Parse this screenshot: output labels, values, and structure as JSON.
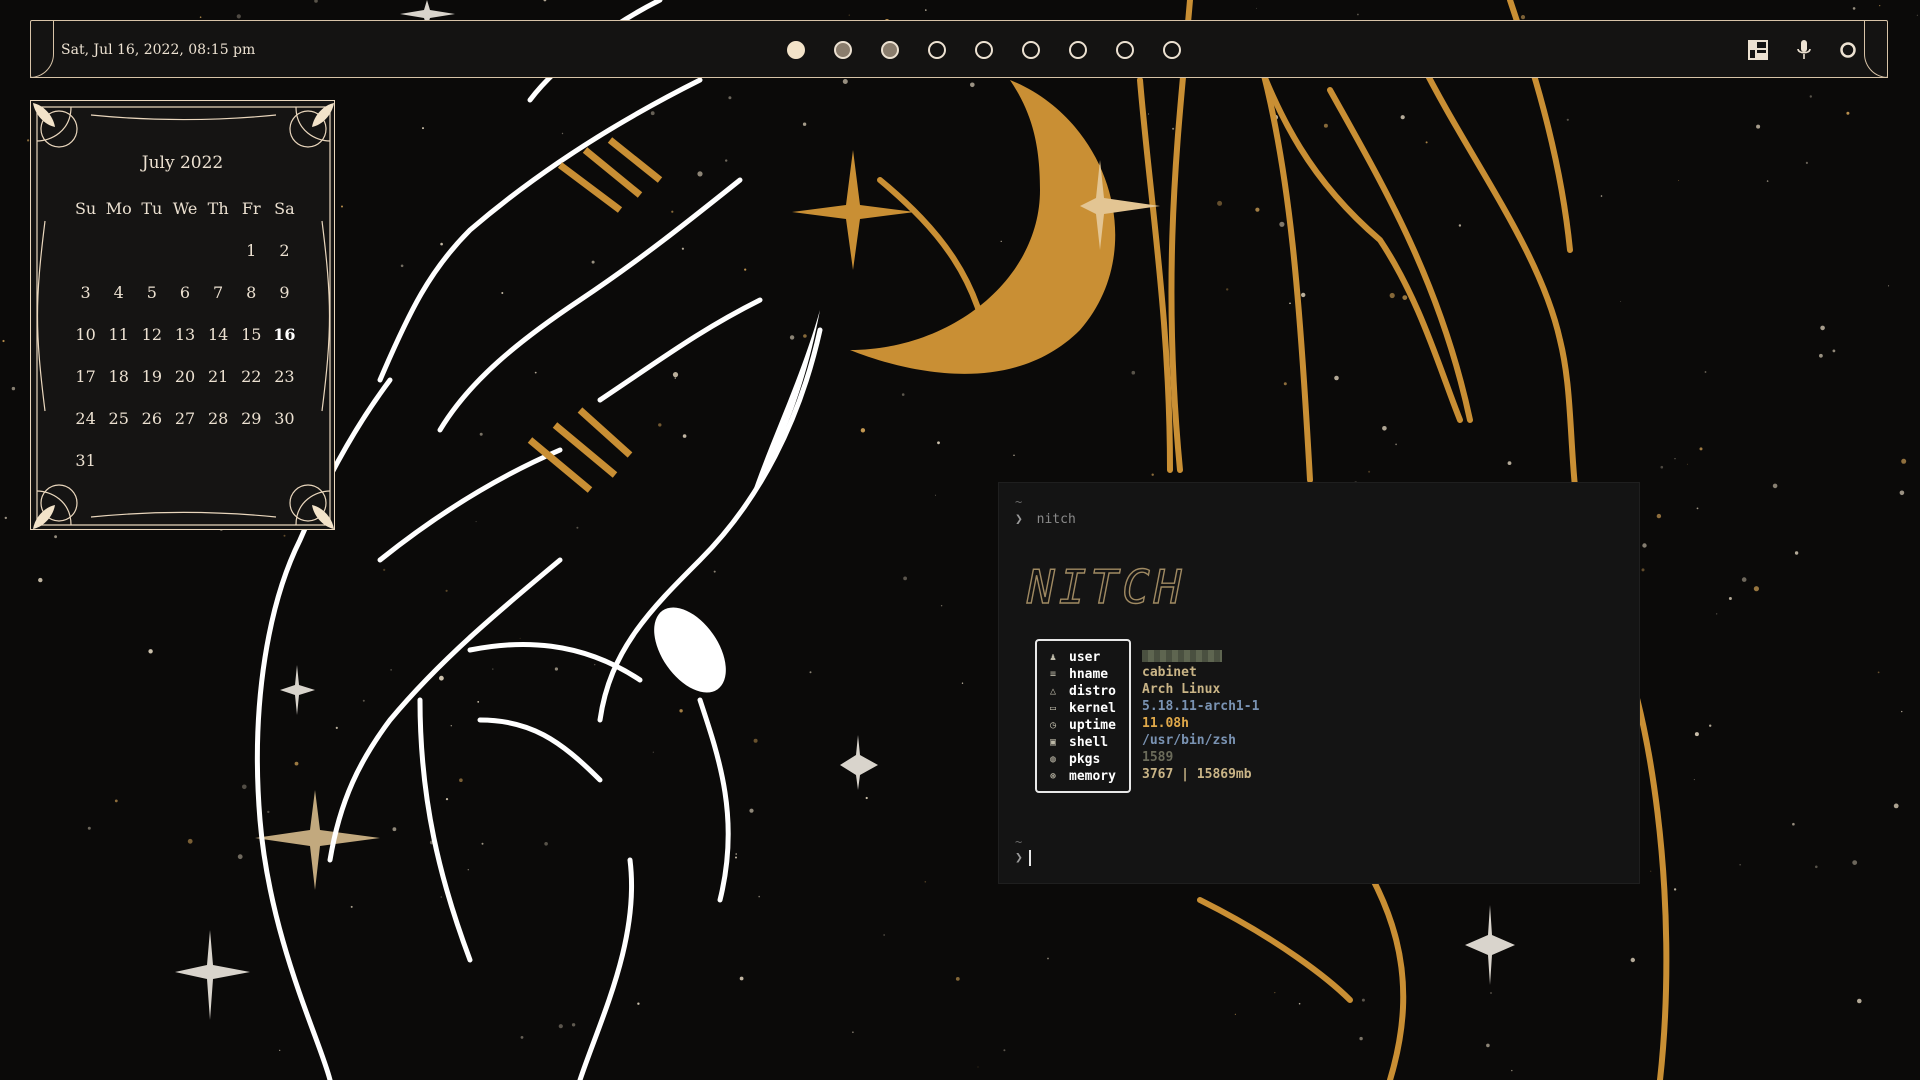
{
  "topbar": {
    "datetime": "Sat, Jul 16, 2022, 08:15 pm",
    "workspaces": [
      {
        "name": "workspace-1",
        "state": "active"
      },
      {
        "name": "workspace-2",
        "state": "occupied"
      },
      {
        "name": "workspace-3",
        "state": "occupied"
      },
      {
        "name": "workspace-4",
        "state": "empty"
      },
      {
        "name": "workspace-5",
        "state": "empty"
      },
      {
        "name": "workspace-6",
        "state": "empty"
      },
      {
        "name": "workspace-7",
        "state": "empty"
      },
      {
        "name": "workspace-8",
        "state": "empty"
      },
      {
        "name": "workspace-9",
        "state": "empty"
      }
    ],
    "right_icons": [
      "layout-icon",
      "microphone-icon",
      "power-icon"
    ]
  },
  "calendar": {
    "title": "July 2022",
    "weekdays": [
      "Su",
      "Mo",
      "Tu",
      "We",
      "Th",
      "Fr",
      "Sa"
    ],
    "days": [
      "",
      "",
      "",
      "",
      "",
      "1",
      "2",
      "3",
      "4",
      "5",
      "6",
      "7",
      "8",
      "9",
      "10",
      "11",
      "12",
      "13",
      "14",
      "15",
      "16",
      "17",
      "18",
      "19",
      "20",
      "21",
      "22",
      "23",
      "24",
      "25",
      "26",
      "27",
      "28",
      "29",
      "30",
      "31"
    ],
    "today": "16"
  },
  "terminal": {
    "tilde": "~",
    "prompt_symbol": "❯",
    "command": "nitch",
    "logo_text": "NITCH",
    "info": [
      {
        "icon": "user-icon",
        "glyph": "♟",
        "label": "user",
        "value": "",
        "color": "#6b6b5a",
        "redacted": true
      },
      {
        "icon": "host-icon",
        "glyph": "≡",
        "label": "hname",
        "value": "cabinet",
        "color": "#c9b486"
      },
      {
        "icon": "distro-icon",
        "glyph": "△",
        "label": "distro",
        "value": "Arch Linux",
        "color": "#c9b486"
      },
      {
        "icon": "kernel-icon",
        "glyph": "▭",
        "label": "kernel",
        "value": "5.18.11-arch1-1",
        "color": "#7a93b3"
      },
      {
        "icon": "uptime-icon",
        "glyph": "◷",
        "label": "uptime",
        "value": "11.08h",
        "color": "#e0a94a"
      },
      {
        "icon": "shell-icon",
        "glyph": "▣",
        "label": "shell",
        "value": "/usr/bin/zsh",
        "color": "#7a93b3"
      },
      {
        "icon": "package-icon",
        "glyph": "◍",
        "label": "pkgs",
        "value": "1589",
        "color": "#6b6b5a"
      },
      {
        "icon": "memory-icon",
        "glyph": "⊛",
        "label": "memory",
        "value": "3767 | 15869mb",
        "color": "#c9b486"
      }
    ]
  }
}
